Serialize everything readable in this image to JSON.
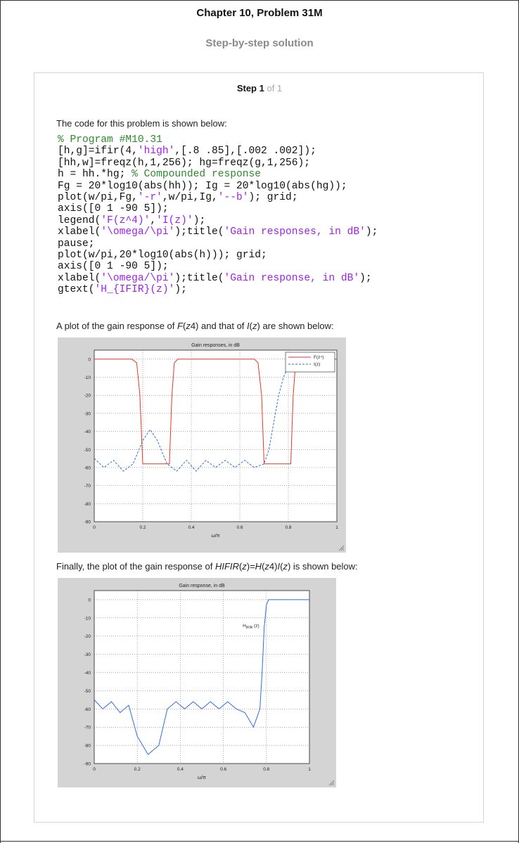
{
  "header": {
    "title": "Chapter 10, Problem 31M",
    "subtitle": "Step-by-step solution"
  },
  "step": {
    "label": "Step 1",
    "of_text": "of 1"
  },
  "content": {
    "intro": "The code for this problem is shown below:",
    "code_lines": [
      [
        {
          "t": "% Program #M10.31",
          "k": "com"
        }
      ],
      [
        {
          "t": "[h,g]=ifir(4,",
          "k": "n"
        },
        {
          "t": "'high'",
          "k": "str"
        },
        {
          "t": ",[.8 .85],[.002 .002]);",
          "k": "n"
        }
      ],
      [
        {
          "t": "[hh,w]=freqz(h,1,256); hg=freqz(g,1,256);",
          "k": "n"
        }
      ],
      [
        {
          "t": "h = hh.*hg; ",
          "k": "n"
        },
        {
          "t": "% Compounded response",
          "k": "com"
        }
      ],
      [
        {
          "t": "Fg = 20*log10(abs(hh)); Ig = 20*log10(abs(hg));",
          "k": "n"
        }
      ],
      [
        {
          "t": "plot(w/pi,Fg,",
          "k": "n"
        },
        {
          "t": "'-r'",
          "k": "str"
        },
        {
          "t": ",w/pi,Ig,",
          "k": "n"
        },
        {
          "t": "'--b'",
          "k": "str"
        },
        {
          "t": "); grid;",
          "k": "n"
        }
      ],
      [
        {
          "t": "axis([0 1 -90 5]);",
          "k": "n"
        }
      ],
      [
        {
          "t": "legend(",
          "k": "n"
        },
        {
          "t": "'F(z^4)'",
          "k": "str"
        },
        {
          "t": ",",
          "k": "n"
        },
        {
          "t": "'I(z)'",
          "k": "str"
        },
        {
          "t": ");",
          "k": "n"
        }
      ],
      [
        {
          "t": "xlabel(",
          "k": "n"
        },
        {
          "t": "'\\omega/\\pi'",
          "k": "str"
        },
        {
          "t": ");title(",
          "k": "n"
        },
        {
          "t": "'Gain responses, in dB'",
          "k": "str"
        },
        {
          "t": ");",
          "k": "n"
        }
      ],
      [
        {
          "t": "pause;",
          "k": "n"
        }
      ],
      [
        {
          "t": "plot(w/pi,20*log10(abs(h))); grid;",
          "k": "n"
        }
      ],
      [
        {
          "t": "axis([0 1 -90 5]);",
          "k": "n"
        }
      ],
      [
        {
          "t": "xlabel(",
          "k": "n"
        },
        {
          "t": "'\\omega/\\pi'",
          "k": "str"
        },
        {
          "t": ");title(",
          "k": "n"
        },
        {
          "t": "'Gain response, in dB'",
          "k": "str"
        },
        {
          "t": ");",
          "k": "n"
        }
      ],
      [
        {
          "t": "gtext(",
          "k": "n"
        },
        {
          "t": "'H_{IFIR}(z)'",
          "k": "str"
        },
        {
          "t": ");",
          "k": "n"
        }
      ]
    ],
    "para1": [
      {
        "t": "A plot of the gain response of ",
        "i": false
      },
      {
        "t": "F",
        "i": true
      },
      {
        "t": "(",
        "i": false
      },
      {
        "t": "z",
        "i": true
      },
      {
        "t": "4) and that of ",
        "i": false
      },
      {
        "t": "I",
        "i": true
      },
      {
        "t": "(",
        "i": false
      },
      {
        "t": "z",
        "i": true
      },
      {
        "t": ") are shown below:",
        "i": false
      }
    ],
    "para2": [
      {
        "t": "Finally, the plot of the gain response of ",
        "i": false
      },
      {
        "t": "HIFIR",
        "i": true
      },
      {
        "t": "(",
        "i": false
      },
      {
        "t": "z",
        "i": true
      },
      {
        "t": ")=",
        "i": false
      },
      {
        "t": "H",
        "i": true
      },
      {
        "t": "(",
        "i": false
      },
      {
        "t": "z",
        "i": true
      },
      {
        "t": "4)",
        "i": false
      },
      {
        "t": "I",
        "i": true
      },
      {
        "t": "(",
        "i": false
      },
      {
        "t": "z",
        "i": true
      },
      {
        "t": ") is shown below:",
        "i": false
      }
    ]
  },
  "colors": {
    "red_series": "#e8372a",
    "blue_series": "#2f6fd6",
    "code_comment": "#2d8a2d",
    "code_string": "#a020f0",
    "figure_bg": "#d4d4d4"
  },
  "chart_data": [
    {
      "type": "line",
      "title": "Gain responses, in dB",
      "xlabel": "ω/π",
      "ylabel": "",
      "xlim": [
        0,
        1
      ],
      "ylim": [
        -90,
        5
      ],
      "xticks": [
        0,
        0.2,
        0.4,
        0.6,
        0.8,
        1
      ],
      "xtick_labels": [
        "0",
        "0.2",
        "0.4",
        "0.6",
        "0.8",
        "1"
      ],
      "yticks": [
        0,
        -10,
        -20,
        -30,
        -40,
        -50,
        -60,
        -70,
        -80,
        -90
      ],
      "ytick_labels": [
        "0",
        "-10",
        "-20",
        "-30",
        "-40",
        "-50",
        "-60",
        "-70",
        "-80",
        "-90"
      ],
      "grid": true,
      "legend": "top-right",
      "series": [
        {
          "name": "F(z⁴)",
          "style": "solid",
          "color": "#e8372a",
          "x": [
            0,
            0.155,
            0.175,
            0.188,
            0.2,
            0.31,
            0.32,
            0.33,
            0.345,
            0.66,
            0.675,
            0.69,
            0.7,
            0.81,
            0.82,
            0.83,
            0.845,
            1
          ],
          "y": [
            0,
            0,
            -2,
            -20,
            -58,
            -58,
            -20,
            -2,
            0,
            0,
            -2,
            -20,
            -58,
            -58,
            -20,
            -2,
            0,
            0
          ]
        },
        {
          "name": "I(z)",
          "style": "dashed",
          "color": "#2f6fd6",
          "x": [
            0,
            0.04,
            0.08,
            0.12,
            0.16,
            0.2,
            0.23,
            0.26,
            0.3,
            0.34,
            0.38,
            0.42,
            0.46,
            0.5,
            0.54,
            0.58,
            0.62,
            0.66,
            0.7,
            0.72,
            0.74,
            0.76,
            0.78,
            0.8,
            0.82
          ],
          "y": [
            -55,
            -60,
            -56,
            -62,
            -58,
            -45,
            -39,
            -45,
            -58,
            -62,
            -56,
            -62,
            -56,
            -60,
            -56,
            -60,
            -56,
            -60,
            -58,
            -50,
            -35,
            -20,
            -10,
            -4,
            0
          ]
        }
      ]
    },
    {
      "type": "line",
      "title": "Gain response, in dB",
      "xlabel": "ω/π",
      "ylabel": "",
      "xlim": [
        0,
        1
      ],
      "ylim": [
        -90,
        5
      ],
      "xticks": [
        0,
        0.2,
        0.4,
        0.6,
        0.8,
        1
      ],
      "xtick_labels": [
        "0",
        "0.2",
        "0.4",
        "0.6",
        "0.8",
        "1"
      ],
      "yticks": [
        0,
        -10,
        -20,
        -30,
        -40,
        -50,
        -60,
        -70,
        -80,
        -90
      ],
      "ytick_labels": [
        "0",
        "-10",
        "-20",
        "-30",
        "-40",
        "-50",
        "-60",
        "-70",
        "-80",
        "-90"
      ],
      "grid": true,
      "annotation": {
        "base": "H",
        "sub": "IFIR",
        "suffix": " (z)",
        "x": 0.69,
        "y": -15
      },
      "series": [
        {
          "name": "",
          "style": "solid",
          "color": "#2f6fd6",
          "x": [
            0,
            0.04,
            0.08,
            0.12,
            0.16,
            0.2,
            0.25,
            0.3,
            0.34,
            0.38,
            0.42,
            0.46,
            0.5,
            0.54,
            0.58,
            0.62,
            0.66,
            0.7,
            0.74,
            0.77,
            0.78,
            0.79,
            0.8,
            0.81,
            0.83,
            1
          ],
          "y": [
            -55,
            -60,
            -56,
            -62,
            -58,
            -75,
            -85,
            -80,
            -60,
            -56,
            -60,
            -56,
            -60,
            -56,
            -60,
            -56,
            -60,
            -62,
            -70,
            -60,
            -40,
            -15,
            -3,
            0,
            0,
            0
          ]
        }
      ]
    }
  ]
}
